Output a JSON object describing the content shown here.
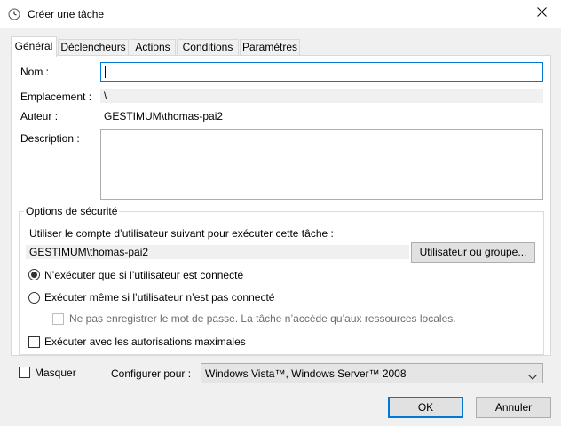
{
  "window": {
    "title": "Créer une tâche",
    "icon": "clock-icon",
    "close_icon": "close-icon"
  },
  "tabs": [
    {
      "label": "Général",
      "active": true
    },
    {
      "label": "Déclencheurs",
      "active": false
    },
    {
      "label": "Actions",
      "active": false
    },
    {
      "label": "Conditions",
      "active": false
    },
    {
      "label": "Paramètres",
      "active": false
    }
  ],
  "general": {
    "name_label": "Nom :",
    "name_value": "",
    "location_label": "Emplacement :",
    "location_value": "\\",
    "author_label": "Auteur :",
    "author_value": "GESTIMUM\\thomas-pai2",
    "description_label": "Description :",
    "description_value": ""
  },
  "security": {
    "title": "Options de sécurité",
    "account_prompt": "Utiliser le compte d’utilisateur suivant pour exécuter cette tâche :",
    "account_value": "GESTIMUM\\thomas-pai2",
    "user_group_button": "Utilisateur ou groupe...",
    "radio_logged_on": "N’exécuter que si l’utilisateur est connecté",
    "radio_logged_on_selected": true,
    "radio_whether": "Exécuter même si l’utilisateur n’est pas connecté",
    "radio_whether_selected": false,
    "no_store_password": "Ne pas enregistrer le mot de passe. La tâche n’accède qu’aux ressources locales.",
    "no_store_password_checked": false,
    "highest_privileges": "Exécuter avec les autorisations maximales",
    "highest_privileges_checked": false
  },
  "footer": {
    "hidden_label": "Masquer",
    "hidden_checked": false,
    "configure_label": "Configurer pour :",
    "configure_value": "Windows Vista™, Windows Server™ 2008",
    "ok_button": "OK",
    "cancel_button": "Annuler"
  },
  "colors": {
    "accent": "#0078d7",
    "button_face": "#e1e1e1",
    "dialog_bg": "#f0f0f0"
  }
}
